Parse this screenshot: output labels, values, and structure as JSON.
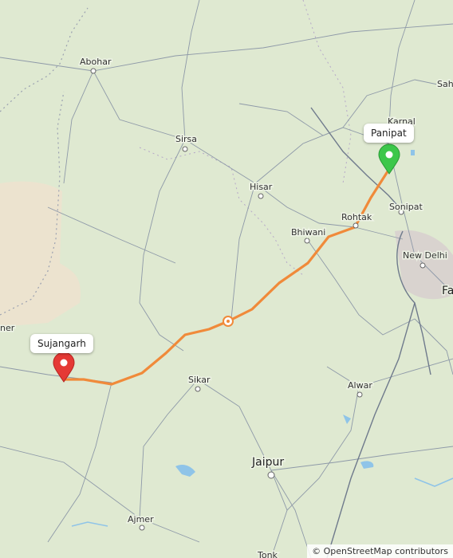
{
  "map": {
    "cities": [
      {
        "id": "abohar",
        "name": "Abohar"
      },
      {
        "id": "sirsa",
        "name": "Sirsa"
      },
      {
        "id": "hisar",
        "name": "Hisar"
      },
      {
        "id": "bhiwani",
        "name": "Bhiwani"
      },
      {
        "id": "rohtak",
        "name": "Rohtak"
      },
      {
        "id": "karnal",
        "name": "Karnal"
      },
      {
        "id": "sonipat",
        "name": "Sonipat"
      },
      {
        "id": "new-delhi",
        "name": "New Delhi"
      },
      {
        "id": "sikar",
        "name": "Sikar"
      },
      {
        "id": "alwar",
        "name": "Alwar"
      },
      {
        "id": "jaipur",
        "name": "Jaipur"
      },
      {
        "id": "ajmer",
        "name": "Ajmer"
      },
      {
        "id": "tonk",
        "name": "Tonk"
      },
      {
        "id": "saharanpur-partial",
        "name": "Saha"
      },
      {
        "id": "faridabad-partial",
        "name": "Fa"
      },
      {
        "id": "left-edge-partial",
        "name": "ner"
      }
    ],
    "route": {
      "color": "#f08a3a",
      "start": "Panipat",
      "end": "Sujangarh"
    },
    "markers": {
      "start": {
        "label": "Panipat",
        "color": "#3cc74a"
      },
      "end": {
        "label": "Sujangarh",
        "color": "#e53935"
      }
    },
    "attribution": "© OpenStreetMap contributors"
  }
}
